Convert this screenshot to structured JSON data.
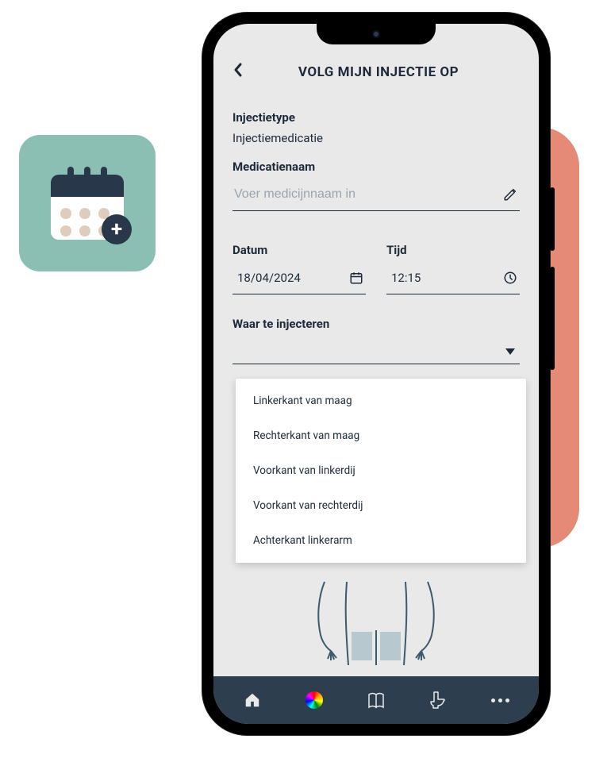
{
  "header": {
    "title": "VOLG MIJN INJECTIE OP"
  },
  "injection_type": {
    "label": "Injectietype",
    "value": "Injectiemedicatie"
  },
  "medication": {
    "label": "Medicatienaam",
    "placeholder": "Voer medicijnnaam in"
  },
  "datetime": {
    "date_label": "Datum",
    "date_value": "18/04/2024",
    "time_label": "Tijd",
    "time_value": "12:15"
  },
  "location": {
    "label": "Waar te injecteren",
    "options": [
      "Linkerkant van maag",
      "Rechterkant van maag",
      "Voorkant van linkerdij",
      "Voorkant van rechterdij",
      "Achterkant linkerarm"
    ]
  },
  "navbar": {
    "items": [
      "home",
      "color",
      "book",
      "toilet",
      "more"
    ]
  }
}
